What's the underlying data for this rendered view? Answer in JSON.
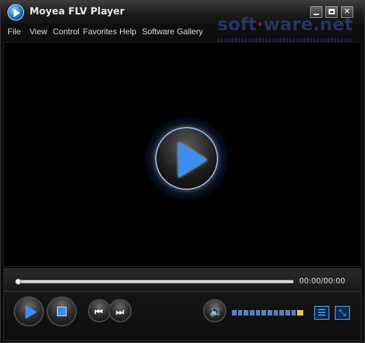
{
  "window": {
    "title": "Moyea FLV Player"
  },
  "menu": [
    {
      "label": "File"
    },
    {
      "label": "View"
    },
    {
      "label": "Control"
    },
    {
      "label": "Favorites"
    },
    {
      "label": "Help"
    },
    {
      "label": "Software Gallery"
    }
  ],
  "watermark": {
    "text_a": "soft",
    "text_b": "ware",
    "text_c": ".net"
  },
  "player": {
    "time": "00:00/00:00",
    "progress": 0,
    "volume_level": 0.9
  },
  "icons": {
    "app": "app-logo-icon",
    "minimize": "minimize-icon",
    "maximize": "maximize-icon",
    "close": "close-icon",
    "big_play": "play-icon",
    "play": "play-icon",
    "stop": "stop-icon",
    "prev": "skip-previous-icon",
    "next": "skip-next-icon",
    "volume": "speaker-icon",
    "playlist": "playlist-icon",
    "fullscreen": "fullscreen-icon"
  },
  "colors": {
    "accent": "#3b8ef0",
    "background": "#000000",
    "volume_high": "#e8c35a"
  }
}
